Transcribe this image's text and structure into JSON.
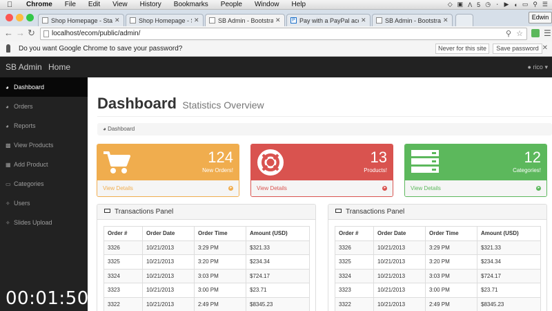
{
  "os_menubar": {
    "app": "Chrome",
    "items": [
      "File",
      "Edit",
      "View",
      "History",
      "Bookmarks",
      "People",
      "Window",
      "Help"
    ],
    "status_text": "5"
  },
  "browser": {
    "tabs": [
      {
        "title": "Shop Homepage - Start Bo"
      },
      {
        "title": "Shop Homepage - Start Bo"
      },
      {
        "title": "SB Admin - Bootstrap Adm"
      },
      {
        "title": "Pay with a PayPal account"
      },
      {
        "title": "SB Admin - Bootstrap Adm"
      }
    ],
    "active_tab": 2,
    "profile_name": "Edwin",
    "url": "localhost/ecom/public/admin/",
    "password_bar": {
      "message": "Do you want Google Chrome to save your password?",
      "never_label": "Never for this site",
      "save_label": "Save password"
    }
  },
  "app": {
    "brand": "SB Admin",
    "home_link": "Home",
    "user": "rico",
    "sidebar": [
      {
        "label": "Dashboard",
        "icon": "dashboard-icon",
        "active": true
      },
      {
        "label": "Orders",
        "icon": "dashboard-icon"
      },
      {
        "label": "Reports",
        "icon": "dashboard-icon"
      },
      {
        "label": "View Products",
        "icon": "bar-chart-icon"
      },
      {
        "label": "Add Product",
        "icon": "table-icon"
      },
      {
        "label": "Categories",
        "icon": "desktop-icon"
      },
      {
        "label": "Users",
        "icon": "wrench-icon"
      },
      {
        "label": "Slides Upload",
        "icon": "wrench-icon"
      }
    ],
    "page_title": "Dashboard",
    "page_subtitle": "Statistics Overview",
    "breadcrumb": "Dashboard",
    "cards": [
      {
        "count": "124",
        "label": "New Orders!",
        "link": "View Details",
        "color": "#f0ad4e",
        "icon": "shopping-cart-icon"
      },
      {
        "count": "13",
        "label": "Products!",
        "link": "View Details",
        "color": "#d9534f",
        "icon": "life-ring-icon"
      },
      {
        "count": "12",
        "label": "Categories!",
        "link": "View Details",
        "color": "#5cb85c",
        "icon": "server-icon"
      }
    ],
    "panels": [
      {
        "title": "Transactions Panel",
        "columns": [
          "Order #",
          "Order Date",
          "Order Time",
          "Amount (USD)"
        ],
        "rows": [
          [
            "3326",
            "10/21/2013",
            "3:29 PM",
            "$321.33"
          ],
          [
            "3325",
            "10/21/2013",
            "3:20 PM",
            "$234.34"
          ],
          [
            "3324",
            "10/21/2013",
            "3:03 PM",
            "$724.17"
          ],
          [
            "3323",
            "10/21/2013",
            "3:00 PM",
            "$23.71"
          ],
          [
            "3322",
            "10/21/2013",
            "2:49 PM",
            "$8345.23"
          ]
        ]
      },
      {
        "title": "Transactions Panel",
        "columns": [
          "Order #",
          "Order Date",
          "Order Time",
          "Amount (USD)"
        ],
        "rows": [
          [
            "3326",
            "10/21/2013",
            "3:29 PM",
            "$321.33"
          ],
          [
            "3325",
            "10/21/2013",
            "3:20 PM",
            "$234.34"
          ],
          [
            "3324",
            "10/21/2013",
            "3:03 PM",
            "$724.17"
          ],
          [
            "3323",
            "10/21/2013",
            "3:00 PM",
            "$23.71"
          ],
          [
            "3322",
            "10/21/2013",
            "2:49 PM",
            "$8345.23"
          ]
        ]
      }
    ]
  },
  "video_timer": "00:01:50"
}
